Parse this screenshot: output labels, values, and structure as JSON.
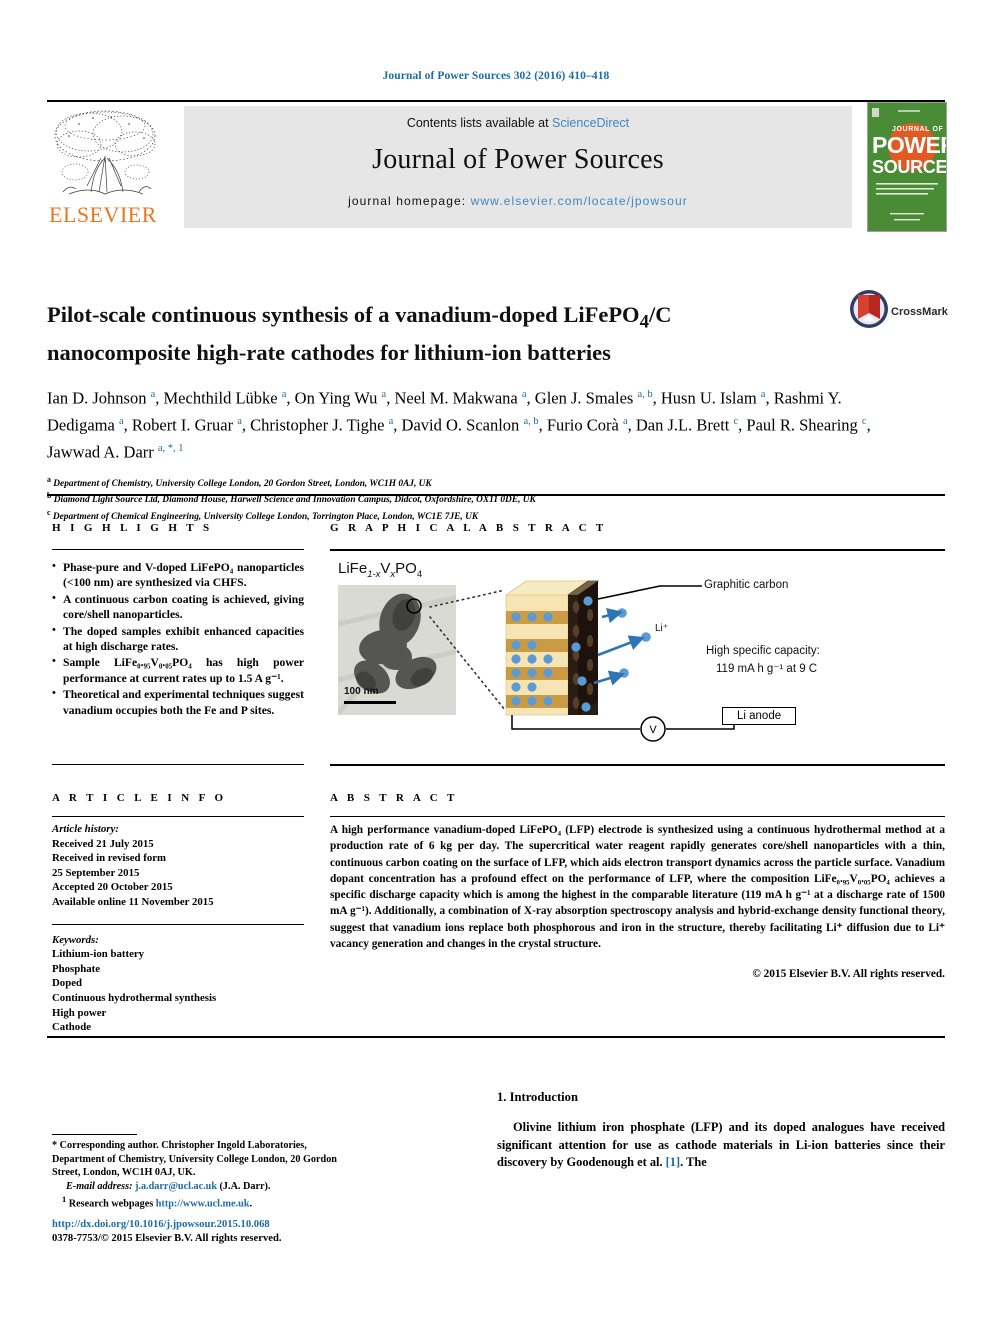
{
  "running_head": "Journal of Power Sources 302 (2016) 410–418",
  "masthead": {
    "contents_prefix": "Contents lists available at",
    "sciencedirect": "ScienceDirect",
    "journal_title": "Journal of Power Sources",
    "homepage_label": "journal homepage:",
    "homepage_url": "www.elsevier.com/locate/jpowsour",
    "publisher": "ELSEVIER",
    "cover_line1": "JOURNAL OF",
    "cover_line2": "POWER",
    "cover_line3": "SOURCES",
    "colors": {
      "link": "#3f87c4",
      "panel": "#e6e6e6",
      "elsevier_orange": "#E87722",
      "cover_green": "#4a8b35",
      "cover_sun": "#e05a22"
    }
  },
  "article": {
    "title_line1": "Pilot-scale continuous synthesis of a vanadium-doped LiFePO",
    "title_sub1": "4",
    "title_line1_tail": "/C",
    "title_line2": "nanocomposite high-rate cathodes for lithium-ion batteries",
    "crossmark_label": "CrossMark",
    "authors_html": "Ian D. Johnson <sup>a</sup>, Mechthild Lübke <sup>a</sup>, On Ying Wu <sup>a</sup>, Neel M. Makwana <sup>a</sup>, Glen J. Smales <sup>a, b</sup>, Husn U. Islam <sup>a</sup>, Rashmi Y. Dedigama <sup>a</sup>, Robert I. Gruar <sup>a</sup>, Christopher J. Tighe <sup>a</sup>, David O. Scanlon <sup>a, b</sup>, Furio Corà <sup>a</sup>, Dan J.L. Brett <sup>c</sup>, Paul R. Shearing <sup>c</sup>, Jawwad A. Darr <sup>a, *, 1</sup>",
    "affiliations": [
      {
        "marker": "a",
        "text": "Department of Chemistry, University College London, 20 Gordon Street, London, WC1H 0AJ, UK"
      },
      {
        "marker": "b",
        "text": "Diamond Light Source Ltd, Diamond House, Harwell Science and Innovation Campus, Didcot, Oxfordshire, OX11 0DE, UK"
      },
      {
        "marker": "c",
        "text": "Department of Chemical Engineering, University College London, Torrington Place, London, WC1E 7JE, UK"
      }
    ]
  },
  "sections": {
    "highlights_head": "H I G H L I G H T S",
    "graphical_abstract_head": "G R A P H I C A L   A B S T R A C T",
    "article_info_head": "A R T I C L E   I N F O",
    "abstract_head": "A B S T R A C T"
  },
  "highlights": [
    "Phase-pure and V-doped LiFePO₄ nanoparticles (<100 nm) are synthesized via CHFS.",
    "A continuous carbon coating is achieved, giving core/shell nanoparticles.",
    "The doped samples exhibit enhanced capacities at high discharge rates.",
    "Sample LiFe₀.₉₅V₀.₀₅PO₄ has high power performance at current rates up to 1.5 A g⁻¹.",
    "Theoretical and experimental techniques suggest vanadium occupies both the Fe and P sites."
  ],
  "graphical_abstract": {
    "tem_formula": "LiFe",
    "tem_sub1": "1-x",
    "tem_v": "V",
    "tem_sub2": "x",
    "tem_po": "PO",
    "tem_sub3": "4",
    "scale_bar": "100 nm",
    "label_graphitic_carbon": "Graphitic carbon",
    "label_li_ion": "Li⁺",
    "label_capacity_line1": "High specific capacity:",
    "label_capacity_line2": "119 mA h g⁻¹ at 9 C",
    "label_li_anode": "Li anode",
    "label_voltmeter": "V",
    "colors": {
      "ion_blue": "#5b9bd5",
      "slab_light": "#f5e2b0",
      "slab_mid": "#c8983d",
      "carbon_dark": "#2b1d12"
    }
  },
  "article_info": {
    "history_head": "Article history:",
    "history": [
      "Received 21 July 2015",
      "Received in revised form",
      "25 September 2015",
      "Accepted 20 October 2015",
      "Available online 11 November 2015"
    ],
    "keywords_head": "Keywords:",
    "keywords": [
      "Lithium-ion battery",
      "Phosphate",
      "Doped",
      "Continuous hydrothermal synthesis",
      "High power",
      "Cathode"
    ]
  },
  "abstract": {
    "body": "A high performance vanadium-doped LiFePO₄ (LFP) electrode is synthesized using a continuous hydrothermal method at a production rate of 6 kg per day. The supercritical water reagent rapidly generates core/shell nanoparticles with a thin, continuous carbon coating on the surface of LFP, which aids electron transport dynamics across the particle surface. Vanadium dopant concentration has a profound effect on the performance of LFP, where the composition LiFe₀.₉₅V₀.₀₅PO₄ achieves a specific discharge capacity which is among the highest in the comparable literature (119 mA h g⁻¹ at a discharge rate of 1500 mA g⁻¹). Additionally, a combination of X-ray absorption spectroscopy analysis and hybrid-exchange density functional theory, suggest that vanadium ions replace both phosphorous and iron in the structure, thereby facilitating Li⁺ diffusion due to Li⁺ vacancy generation and changes in the crystal structure.",
    "copyright": "© 2015 Elsevier B.V. All rights reserved."
  },
  "footnotes": {
    "corresponding": "* Corresponding author. Christopher Ingold Laboratories, Department of Chemistry, University College London, 20 Gordon Street, London, WC1H 0AJ, UK.",
    "email_label": "E-mail address:",
    "email": "j.a.darr@ucl.ac.uk",
    "email_tail": "(J.A. Darr).",
    "research_marker": "1",
    "research_label": "Research webpages",
    "research_url": "http://www.ucl.me.uk",
    "research_tail": ".",
    "doi": "http://dx.doi.org/10.1016/j.jpowsour.2015.10.068",
    "issn_line": "0378-7753/© 2015 Elsevier B.V. All rights reserved."
  },
  "introduction": {
    "heading": "1.  Introduction",
    "paragraph_pre": "Olivine lithium iron phosphate (LFP) and its doped analogues have received significant attention for use as cathode materials in Li-ion batteries since their discovery by Goodenough et al. ",
    "citation": "[1]",
    "paragraph_post": ". The"
  }
}
